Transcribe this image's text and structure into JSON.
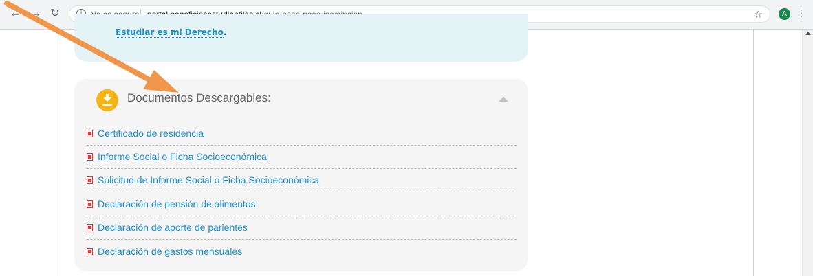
{
  "browser": {
    "security_label": "No es seguro",
    "url_host": "portal.beneficiosestudiantiles.cl",
    "url_path": "/guia-paso-paso-inscripcion",
    "profile_initial": "A",
    "back_icon": "back-arrow-icon",
    "forward_icon": "forward-arrow-icon",
    "reload_icon": "reload-icon",
    "menu_icon": "kebab-menu-icon"
  },
  "top_box": {
    "link_text": "Estudiar es mi Derecho",
    "period": "."
  },
  "documents": {
    "title": "Documentos Descargables:",
    "icon": "download-icon",
    "accent_color": "#f5b41a",
    "link_color": "#1a8fcf",
    "items": [
      {
        "label": "Certificado de residencia"
      },
      {
        "label": "Informe Social o Ficha Socioeconómica"
      },
      {
        "label": "Solicitud de Informe Social o Ficha Socioeconómica"
      },
      {
        "label": "Declaración de pensión de alimentos"
      },
      {
        "label": "Declaración de aporte de parientes"
      },
      {
        "label": "Declaración de gastos mensuales"
      }
    ]
  },
  "annotation": {
    "arrow_color": "#f0964b"
  }
}
